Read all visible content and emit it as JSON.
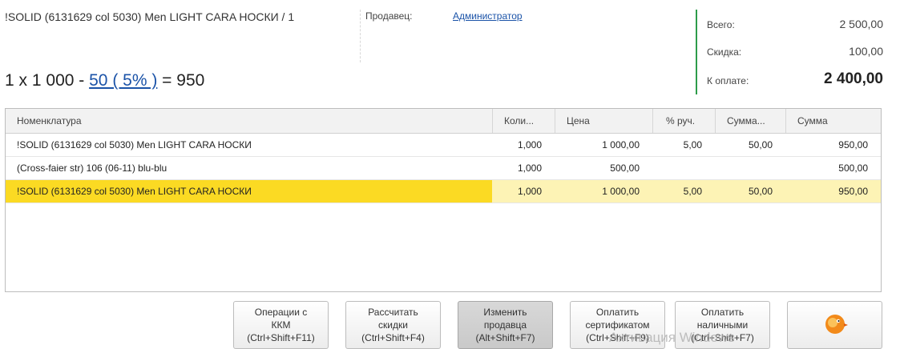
{
  "header": {
    "item_title": "!SOLID (6131629 col 5030) Men LIGHT CARA  НОСКИ / 1",
    "seller_label": "Продавец:",
    "seller_value": "Администратор",
    "calc": {
      "quantity": "1",
      "times": "x",
      "price": "1 000",
      "minus": "-",
      "discount_link": "50 ( 5% )",
      "equals": "=",
      "result": "950"
    }
  },
  "totals": {
    "total_label": "Всего:",
    "total_value": "2 500,00",
    "discount_label": "Скидка:",
    "discount_value": "100,00",
    "pay_label": "К оплате:",
    "pay_value": "2 400,00",
    "accent_color": "#2d9c4a"
  },
  "table": {
    "columns": [
      "Номенклатура",
      "Коли...",
      "Цена",
      "% руч.",
      "Сумма...",
      "Сумма"
    ],
    "rows": [
      {
        "name": "!SOLID (6131629 col 5030) Men LIGHT CARA  НОСКИ",
        "qty": "1,000",
        "price": "1 000,00",
        "pct": "5,00",
        "disc": "50,00",
        "sum": "950,00"
      },
      {
        "name": "(Cross-faier str) 106 (06-11) blu-blu",
        "qty": "1,000",
        "price": "500,00",
        "pct": "",
        "disc": "",
        "sum": "500,00"
      },
      {
        "name": "!SOLID (6131629 col 5030) Men LIGHT CARA  НОСКИ",
        "qty": "1,000",
        "price": "1 000,00",
        "pct": "5,00",
        "disc": "50,00",
        "sum": "950,00"
      }
    ],
    "selected_row_color": "#fbda23"
  },
  "buttons": [
    {
      "line1": "Операции с",
      "line2": "ККМ",
      "line3": "(Ctrl+Shift+F11)"
    },
    {
      "line1": "Рассчитать",
      "line2": "скидки",
      "line3": "(Ctrl+Shift+F4)"
    },
    {
      "line1": "Изменить",
      "line2": "продавца",
      "line3": "(Alt+Shift+F7)"
    },
    {
      "line1": "Оплатить",
      "line2": "сертификатом",
      "line3": "(Ctrl+Shift+F9)"
    },
    {
      "line1": "Оплатить",
      "line2": "наличными",
      "line3": "(Ctrl+Shift+F7)"
    }
  ],
  "icons": {
    "last_button_icon": "bird-icon"
  },
  "watermark": "Активация Windows"
}
